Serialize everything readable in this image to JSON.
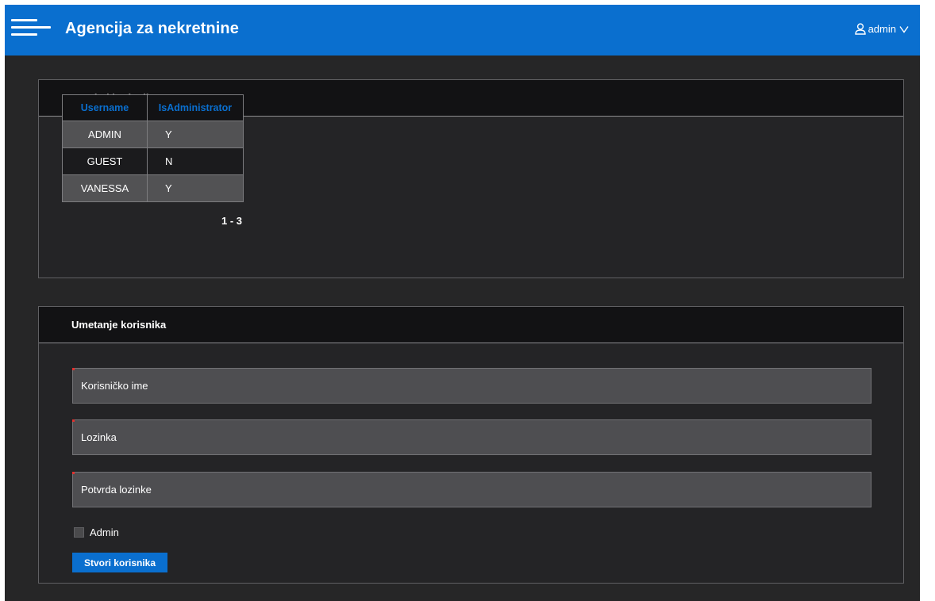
{
  "header": {
    "title": "Agencija za nekretnine",
    "username": "admin"
  },
  "users_panel": {
    "title": "Pregled korisnika",
    "columns": [
      "Username",
      "IsAdministrator"
    ],
    "rows": [
      [
        "ADMIN",
        "Y"
      ],
      [
        "GUEST",
        "N"
      ],
      [
        "VANESSA",
        "Y"
      ]
    ],
    "pagination": "1 - 3"
  },
  "insert_panel": {
    "title": "Umetanje korisnika",
    "username_placeholder": "Korisničko ime",
    "password_placeholder": "Lozinka",
    "confirm_placeholder": "Potvrda lozinke",
    "admin_label": "Admin",
    "submit_label": "Stvori korisnika"
  },
  "colors": {
    "accent": "#0a6fcf",
    "required_marker": "#e2312e"
  },
  "icons": {
    "menu": "hamburger-menu-icon",
    "user": "user-icon",
    "dropdown": "chevron-down-icon"
  }
}
